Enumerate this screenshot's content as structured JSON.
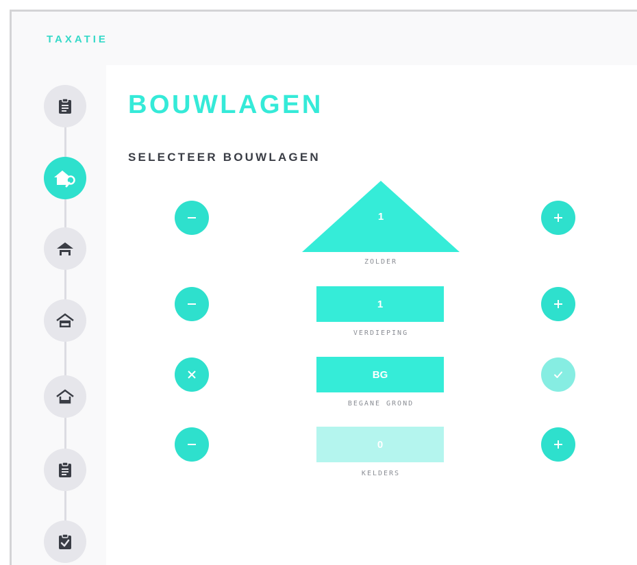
{
  "app": {
    "title": "TAXATIE"
  },
  "page": {
    "title": "BOUWLAGEN",
    "subtitle": "SELECTEER BOUWLAGEN"
  },
  "stepper": {
    "steps": [
      {
        "icon": "clipboard-icon",
        "active": false
      },
      {
        "icon": "house-search-icon",
        "active": true
      },
      {
        "icon": "roof-icon",
        "active": false
      },
      {
        "icon": "floor-icon",
        "active": false
      },
      {
        "icon": "ground-floor-icon",
        "active": false
      },
      {
        "icon": "clipboard-list-icon",
        "active": false
      },
      {
        "icon": "clipboard-check-icon",
        "active": false
      }
    ]
  },
  "layers": [
    {
      "key": "zolder",
      "value": "1",
      "label": "ZOLDER",
      "left_button": "minus-icon",
      "right_button": "plus-icon"
    },
    {
      "key": "verdieping",
      "value": "1",
      "label": "VERDIEPING",
      "left_button": "minus-icon",
      "right_button": "plus-icon"
    },
    {
      "key": "begane_grond",
      "value": "BG",
      "label": "BEGANE GROND",
      "left_button": "close-icon",
      "right_button": "check-icon"
    },
    {
      "key": "kelders",
      "value": "0",
      "label": "KELDERS",
      "left_button": "minus-icon",
      "right_button": "plus-icon"
    }
  ],
  "colors": {
    "accent": "#2ee0cd",
    "accent_bright": "#35ecd8",
    "accent_light": "#86ede2",
    "accent_faded": "#b4f5ee",
    "title": "#35ead8",
    "text_dark": "#3a3d45",
    "text_muted": "#8a8d94",
    "step_inactive": "#e6e6eb"
  }
}
